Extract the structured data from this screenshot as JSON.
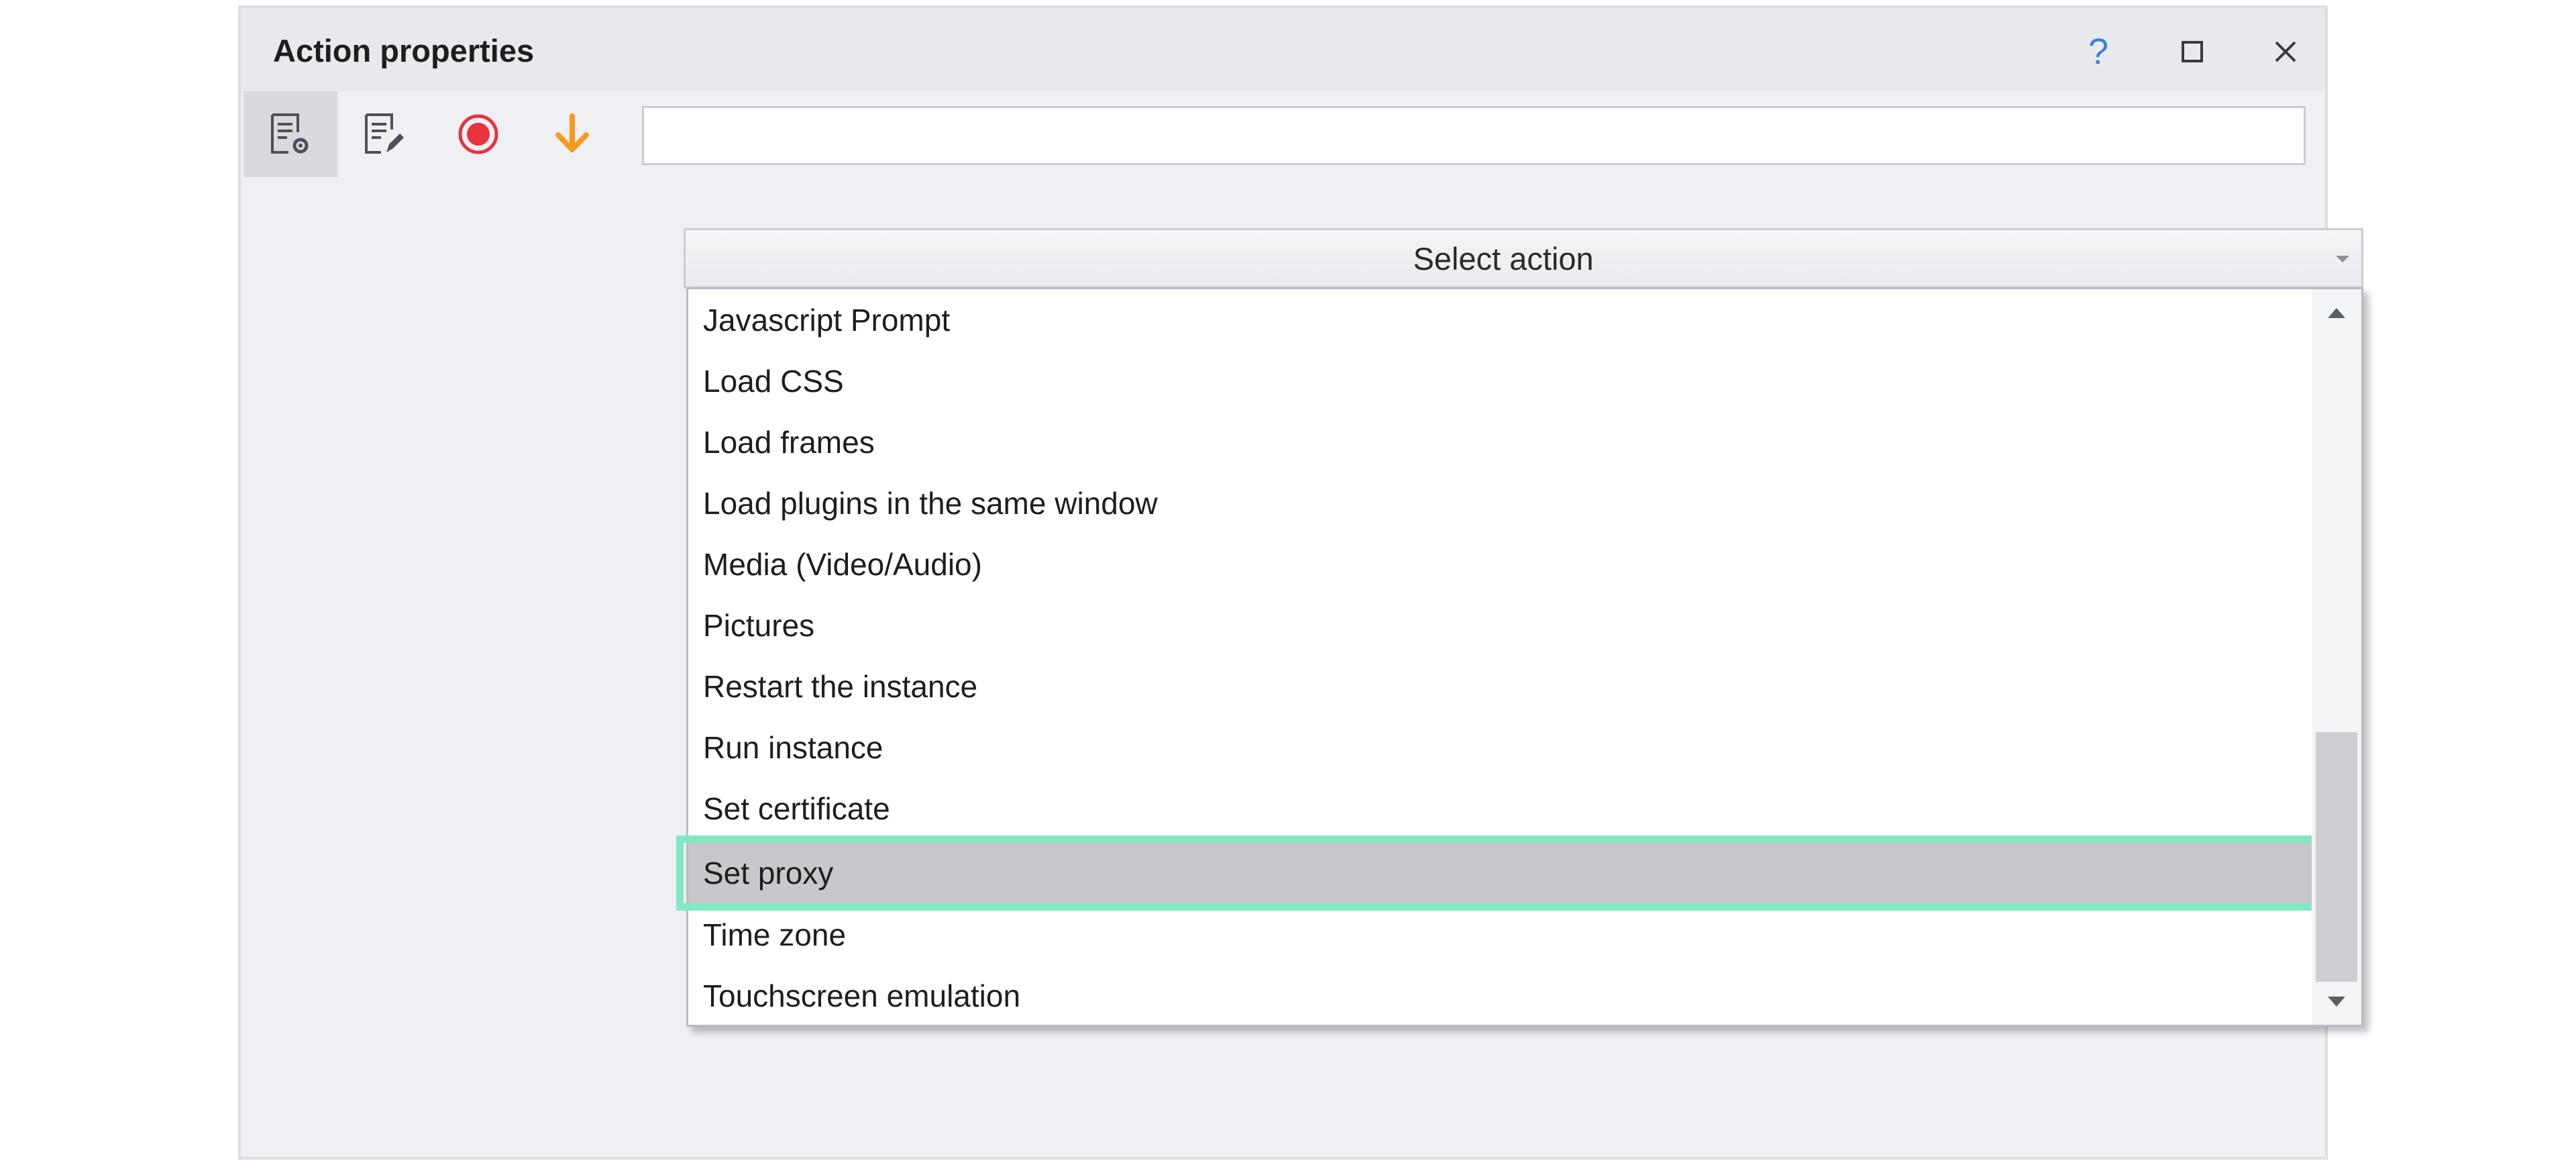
{
  "window": {
    "title": "Action properties",
    "help_label": "?",
    "icons": {
      "help": "question-mark-icon",
      "maximize": "maximize-icon",
      "close": "close-icon"
    }
  },
  "toolbar": {
    "buttons": [
      {
        "icon": "action-properties-icon",
        "active": true
      },
      {
        "icon": "edit-notes-icon",
        "active": false
      },
      {
        "icon": "record-icon",
        "active": false
      },
      {
        "icon": "arrow-down-icon",
        "active": false
      }
    ],
    "search_value": ""
  },
  "select": {
    "label": "Select action"
  },
  "dropdown": {
    "items": [
      {
        "label": "Javascript Prompt"
      },
      {
        "label": "Load CSS"
      },
      {
        "label": "Load frames"
      },
      {
        "label": "Load plugins in the same window"
      },
      {
        "label": "Media (Video/Audio)"
      },
      {
        "label": "Pictures"
      },
      {
        "label": "Restart the instance"
      },
      {
        "label": "Run instance"
      },
      {
        "label": "Set certificate"
      },
      {
        "label": "Set proxy"
      },
      {
        "label": "Time zone"
      },
      {
        "label": "Touchscreen emulation"
      }
    ],
    "selected_label": "Set proxy"
  },
  "colors": {
    "accent_highlight": "#83e8c1",
    "record": "#e8323c",
    "arrow": "#f59a1e",
    "help": "#3b7fd6",
    "selected_row": "#c7c8cc"
  }
}
